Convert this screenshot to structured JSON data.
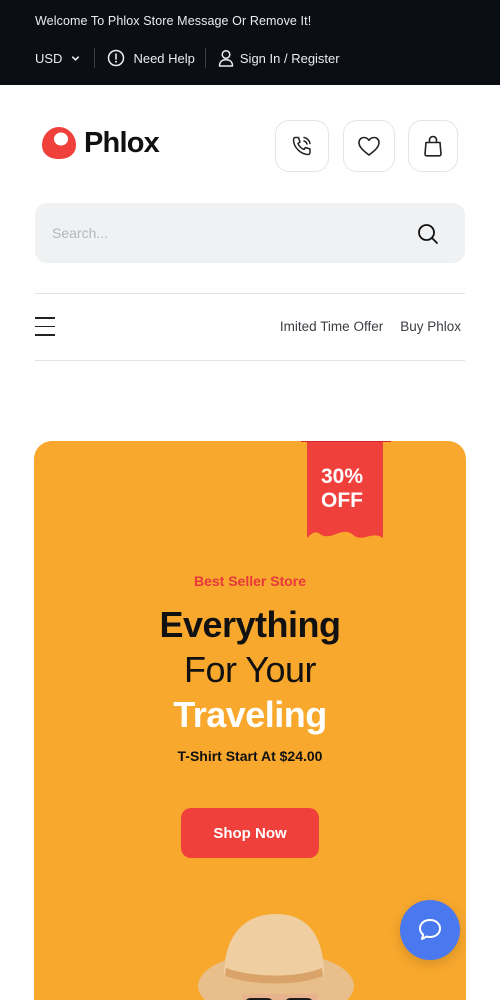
{
  "topbar": {
    "welcome": "Welcome To Phlox Store Message Or Remove It!",
    "currency": "USD",
    "help_label": "Need Help",
    "signin_label": "Sign In / Register"
  },
  "header": {
    "logo_text": "Phlox",
    "icons": [
      "phone-icon",
      "heart-icon",
      "bag-icon"
    ]
  },
  "search": {
    "placeholder": "Search..."
  },
  "nav": {
    "links": [
      "Imited Time Offer",
      "Buy Phlox"
    ]
  },
  "hero": {
    "ribbon_line1": "30%",
    "ribbon_line2": "OFF",
    "tagline": "Best Seller Store",
    "title_line1": "Everything",
    "title_line2": "For Your",
    "title_line3": "Traveling",
    "price_line": "T-Shirt Start At $24.00",
    "cta": "Shop Now"
  },
  "colors": {
    "topbar_bg": "#0b0f14",
    "hero_bg": "#f8a82d",
    "accent_red": "#f0403b",
    "chat_blue": "#4a78ee"
  }
}
